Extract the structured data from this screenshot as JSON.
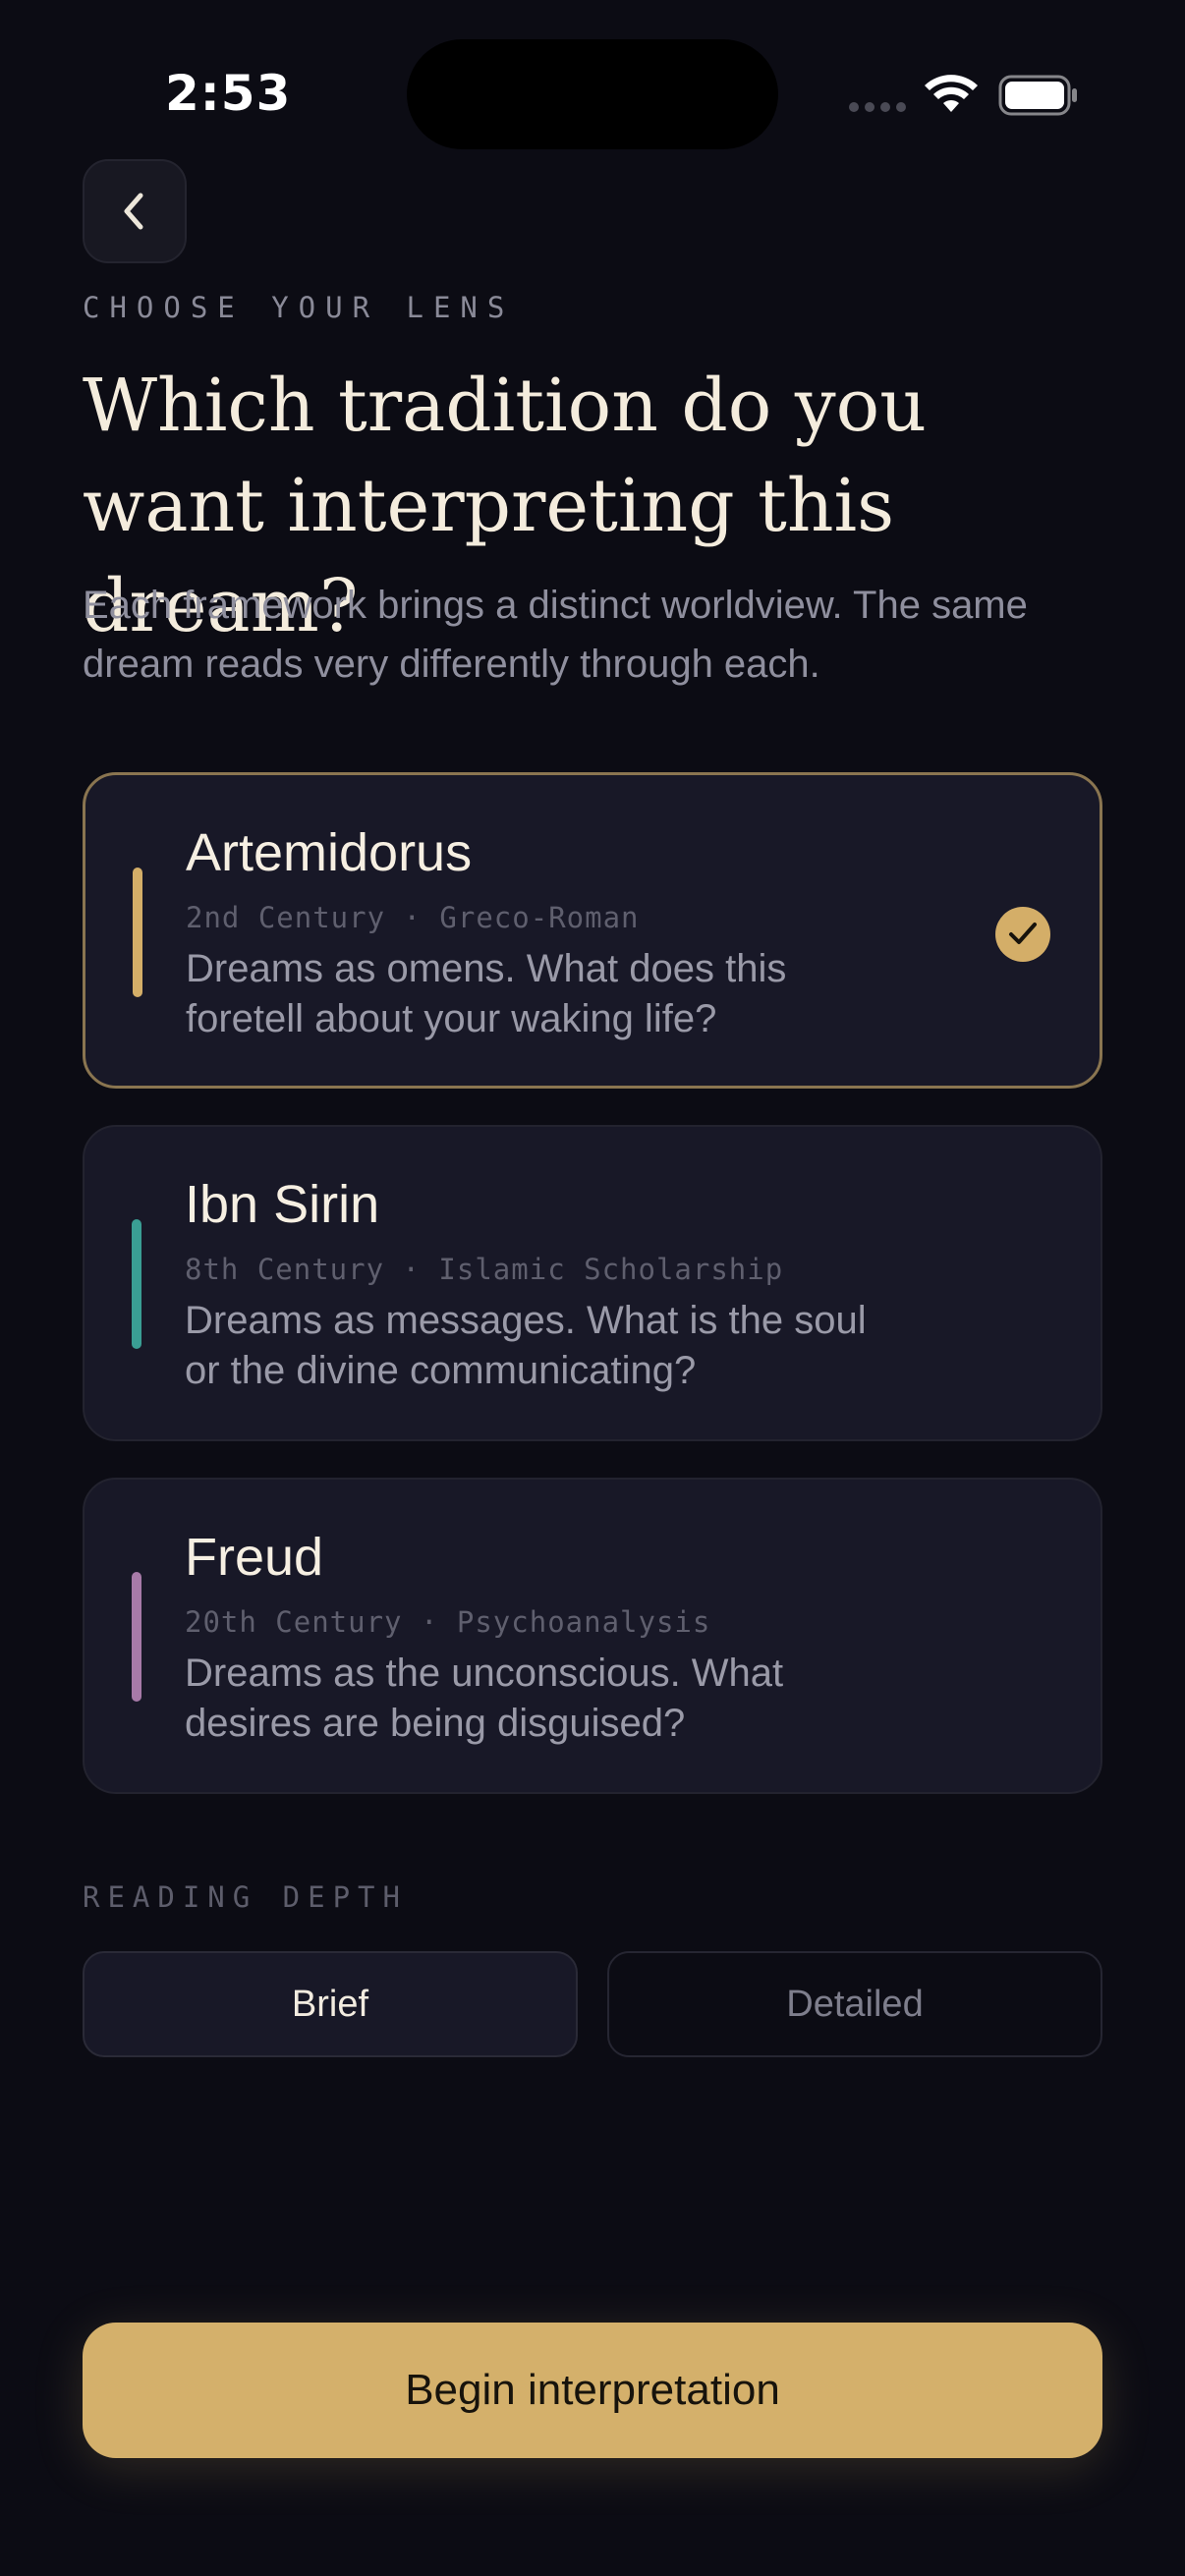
{
  "status": {
    "time": "2:53"
  },
  "header": {
    "eyebrow": "CHOOSE YOUR LENS",
    "title": "Which tradition do you want interpreting this dream?",
    "subtitle": "Each framework brings a distinct worldview. The same dream reads very differently through each."
  },
  "traditions": [
    {
      "name": "Artemidorus",
      "meta": "2nd Century · Greco-Roman",
      "description": "Dreams as omens. What does this foretell about your waking life?",
      "accent": "#d4ae68",
      "selected": true
    },
    {
      "name": "Ibn Sirin",
      "meta": "8th Century · Islamic Scholarship",
      "description": "Dreams as messages. What is the soul or the divine communicating?",
      "accent": "#3a9e94",
      "selected": false
    },
    {
      "name": "Freud",
      "meta": "20th Century · Psychoanalysis",
      "description": "Dreams as the unconscious. What desires are being disguised?",
      "accent": "#a77aa8",
      "selected": false
    }
  ],
  "depth": {
    "label": "READING DEPTH",
    "options": [
      "Brief",
      "Detailed"
    ],
    "selected": "Brief"
  },
  "cta": {
    "label": "Begin interpretation"
  },
  "colors": {
    "background": "#0c0c14",
    "card": "#181827",
    "gold": "#d4b06b"
  },
  "icons": {
    "back": "chevron-left-icon",
    "check": "checkmark-icon"
  }
}
